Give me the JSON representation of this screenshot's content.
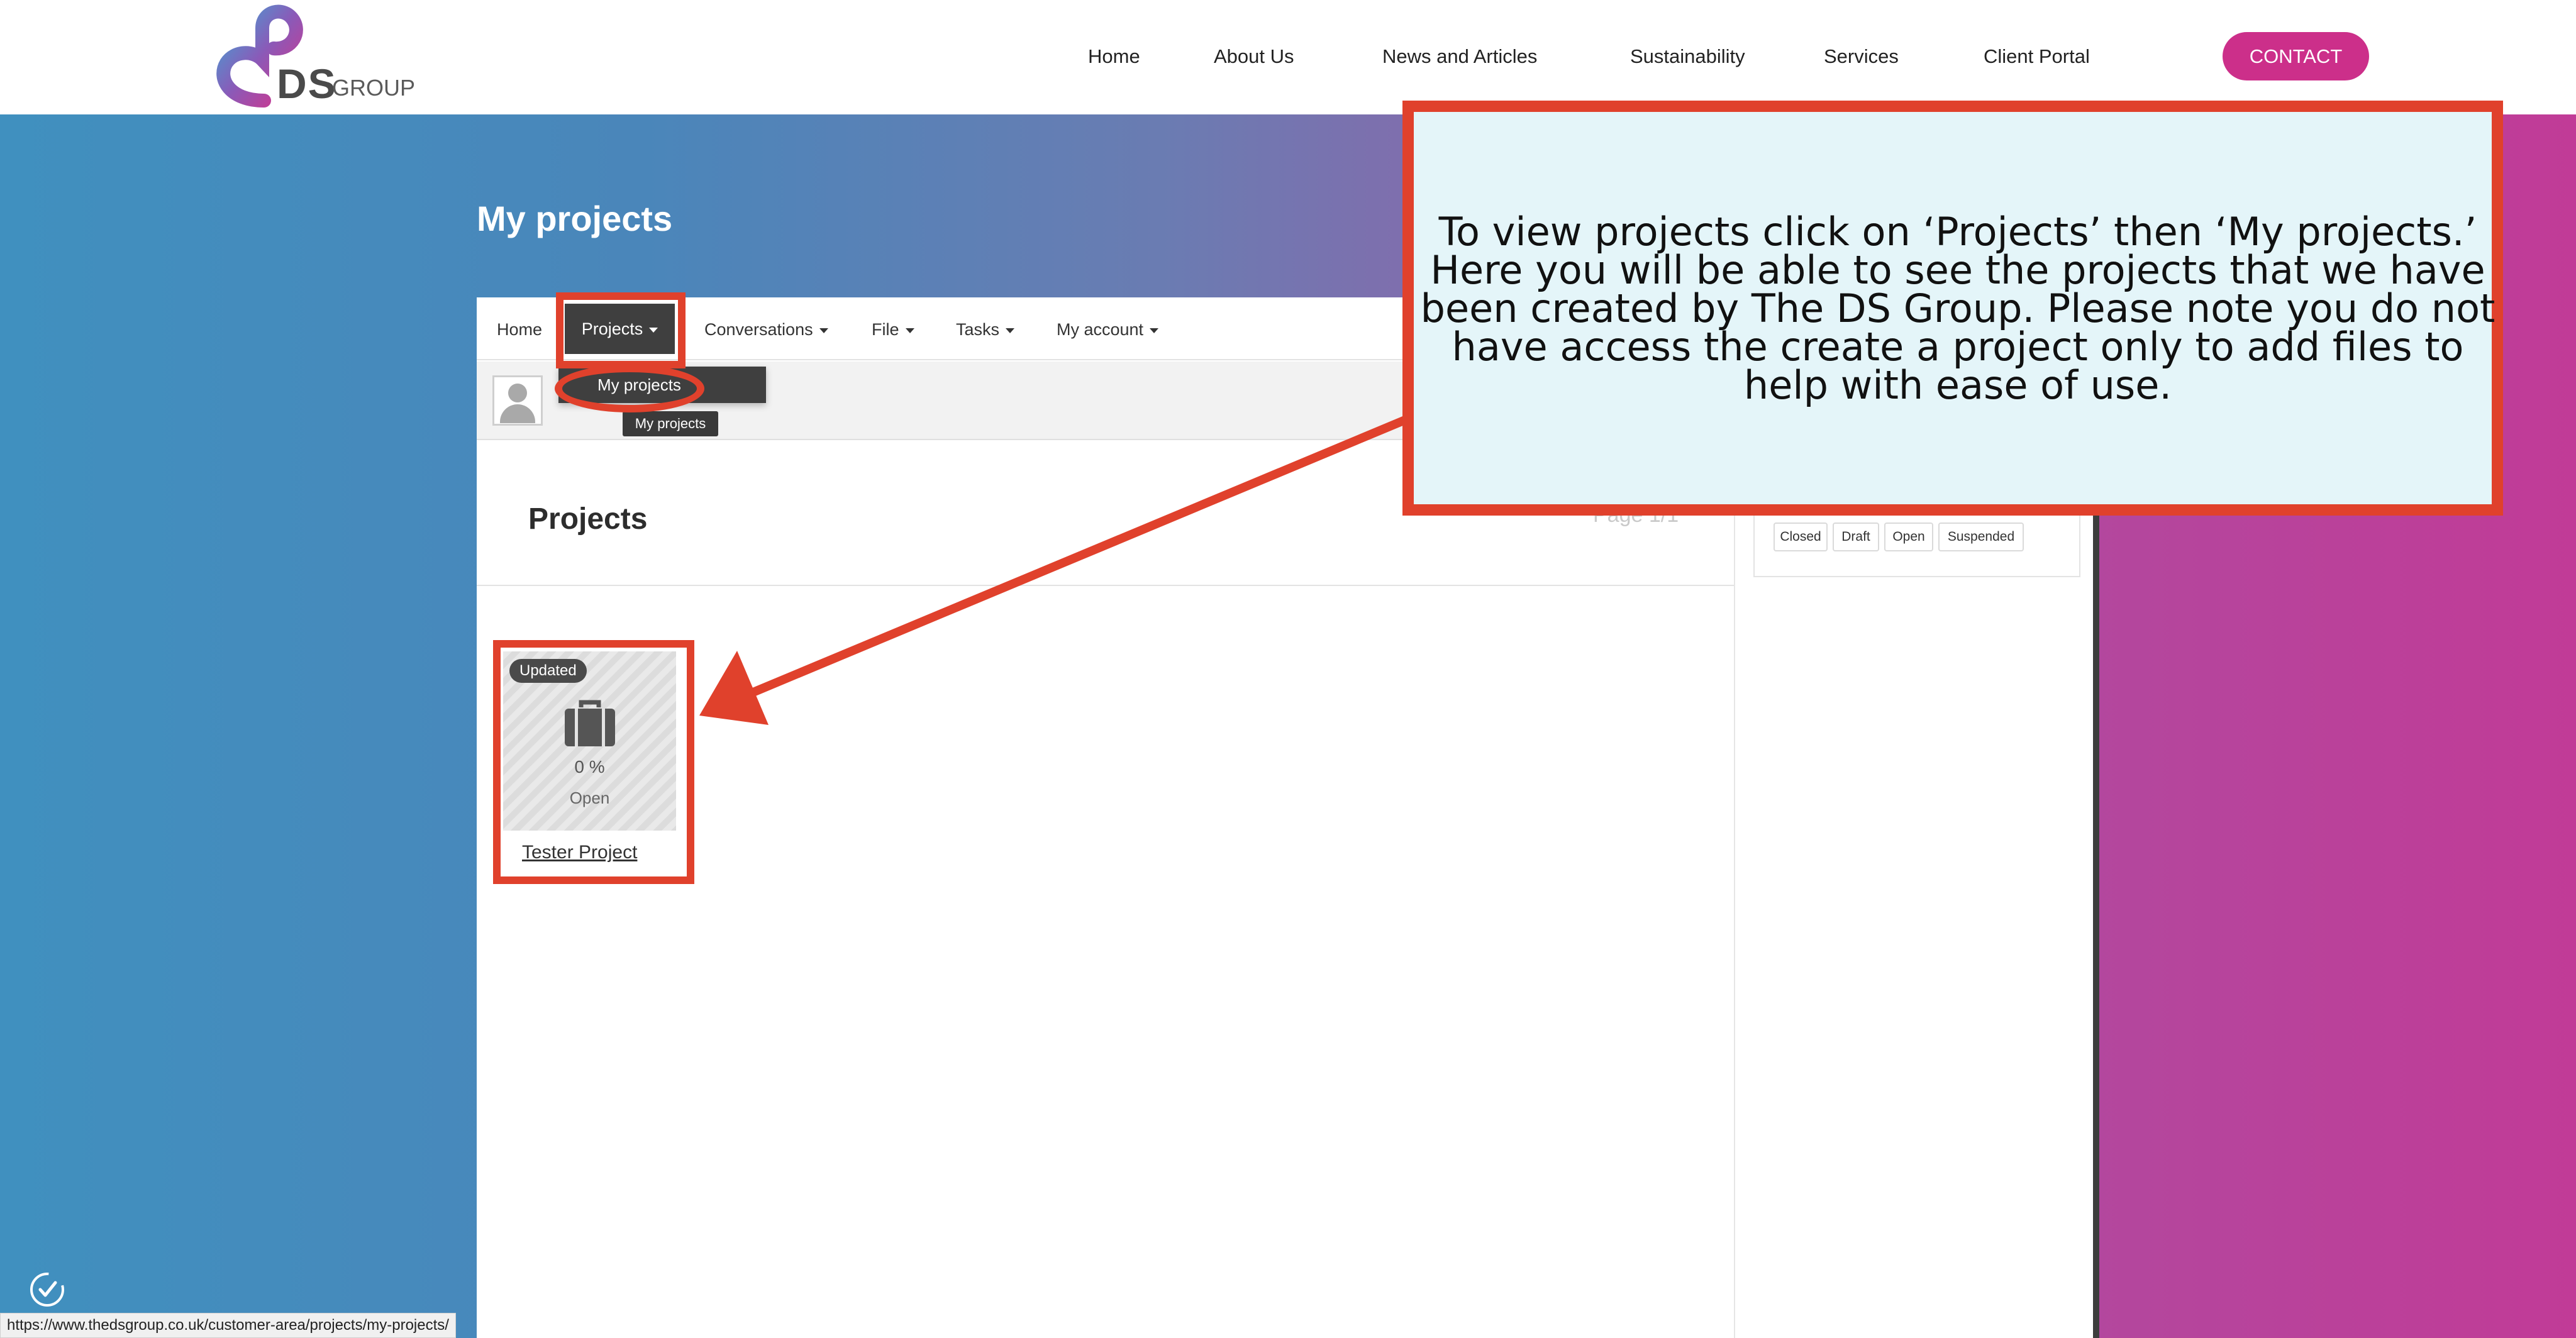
{
  "header": {
    "logo_text": "DS",
    "logo_sub": "GROUP",
    "nav": [
      "Home",
      "About Us",
      "News and Articles",
      "Sustainability",
      "Services",
      "Client Portal"
    ],
    "contact_label": "CONTACT"
  },
  "page": {
    "title": "My projects"
  },
  "portal_nav": {
    "home": "Home",
    "projects": "Projects",
    "conversations": "Conversations",
    "file": "File",
    "tasks": "Tasks",
    "my_account": "My account"
  },
  "dropdown": {
    "item": "My projects",
    "tooltip": "My projects"
  },
  "projects": {
    "heading": "Projects",
    "page_indicator": "Page 1/1",
    "filters": [
      "Closed",
      "Draft",
      "Open",
      "Suspended"
    ],
    "card": {
      "badge": "Updated",
      "progress": "0 %",
      "status": "Open",
      "title": "Tester Project",
      "icon": "briefcase-icon"
    }
  },
  "annotation": {
    "callout_text": "To view projects click on ‘Projects’ then ‘My projects.’ Here you will be able to see the projects that we have been created by The DS Group. Please note you do not have access the create a project only to add files to help with ease of use.",
    "color": "#e0412c"
  },
  "status_bar": {
    "url": "https://www.thedsgroup.co.uk/customer-area/projects/my-projects/"
  },
  "colors": {
    "brand_pink": "#cc2f8a",
    "gradient_start": "#4090bf",
    "gradient_end": "#c13b97"
  }
}
